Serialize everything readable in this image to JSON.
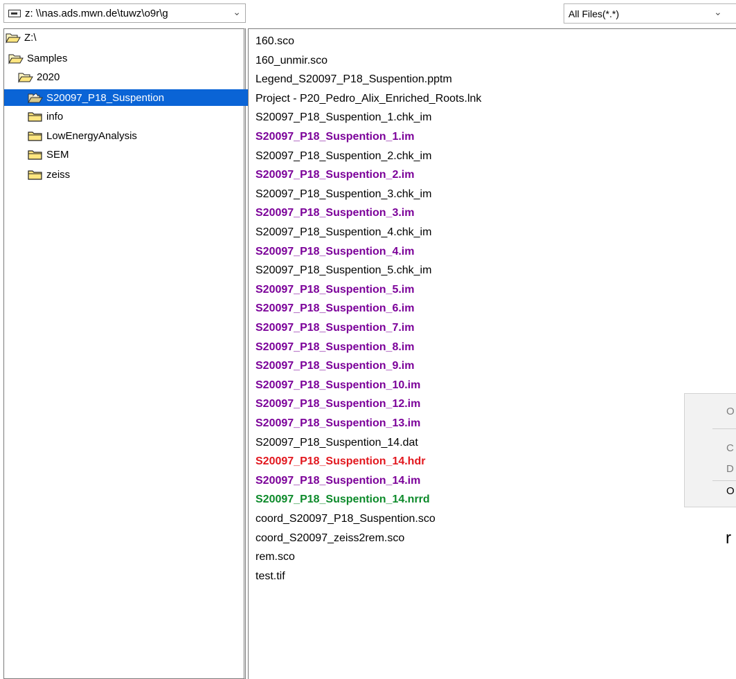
{
  "drive_combo": {
    "value": "z: \\\\nas.ads.mwn.de\\tuwz\\o9r\\g",
    "arrow": "chevron-down-icon"
  },
  "filter_combo": {
    "value": "All Files(*.*)",
    "arrow": "chevron-down-icon"
  },
  "tree": {
    "items": [
      {
        "label": "Z:\\",
        "icon": "open-folder-icon",
        "selected": false
      },
      {
        "label": "Samples",
        "icon": "open-folder-icon",
        "selected": false
      },
      {
        "label": "2020",
        "icon": "open-folder-icon",
        "selected": false
      },
      {
        "label": "S20097_P18_Suspention",
        "icon": "open-folder-icon",
        "selected": true
      },
      {
        "label": "info",
        "icon": "folder-icon",
        "selected": false
      },
      {
        "label": "LowEnergyAnalysis",
        "icon": "folder-icon",
        "selected": false
      },
      {
        "label": "SEM",
        "icon": "folder-icon",
        "selected": false
      },
      {
        "label": "zeiss",
        "icon": "folder-icon",
        "selected": false
      }
    ]
  },
  "files": [
    {
      "name": "160.sco",
      "style": "normal",
      "color": "#000000"
    },
    {
      "name": "160_unmir.sco",
      "style": "normal",
      "color": "#000000"
    },
    {
      "name": "Legend_S20097_P18_Suspention.pptm",
      "style": "normal",
      "color": "#000000"
    },
    {
      "name": "Project - P20_Pedro_Alix_Enriched_Roots.lnk",
      "style": "normal",
      "color": "#000000"
    },
    {
      "name": "S20097_P18_Suspention_1.chk_im",
      "style": "normal",
      "color": "#000000"
    },
    {
      "name": "S20097_P18_Suspention_1.im",
      "style": "bold",
      "color": "#7b0099"
    },
    {
      "name": "S20097_P18_Suspention_2.chk_im",
      "style": "normal",
      "color": "#000000"
    },
    {
      "name": "S20097_P18_Suspention_2.im",
      "style": "bold",
      "color": "#7b0099"
    },
    {
      "name": "S20097_P18_Suspention_3.chk_im",
      "style": "normal",
      "color": "#000000"
    },
    {
      "name": "S20097_P18_Suspention_3.im",
      "style": "bold",
      "color": "#7b0099"
    },
    {
      "name": "S20097_P18_Suspention_4.chk_im",
      "style": "normal",
      "color": "#000000"
    },
    {
      "name": "S20097_P18_Suspention_4.im",
      "style": "bold",
      "color": "#7b0099"
    },
    {
      "name": "S20097_P18_Suspention_5.chk_im",
      "style": "normal",
      "color": "#000000"
    },
    {
      "name": "S20097_P18_Suspention_5.im",
      "style": "bold",
      "color": "#7b0099"
    },
    {
      "name": "S20097_P18_Suspention_6.im",
      "style": "bold",
      "color": "#7b0099"
    },
    {
      "name": "S20097_P18_Suspention_7.im",
      "style": "bold",
      "color": "#7b0099"
    },
    {
      "name": "S20097_P18_Suspention_8.im",
      "style": "bold",
      "color": "#7b0099"
    },
    {
      "name": "S20097_P18_Suspention_9.im",
      "style": "bold",
      "color": "#7b0099"
    },
    {
      "name": "S20097_P18_Suspention_10.im",
      "style": "bold",
      "color": "#7b0099"
    },
    {
      "name": "S20097_P18_Suspention_12.im",
      "style": "bold",
      "color": "#7b0099"
    },
    {
      "name": "S20097_P18_Suspention_13.im",
      "style": "bold",
      "color": "#7b0099"
    },
    {
      "name": "S20097_P18_Suspention_14.dat",
      "style": "normal",
      "color": "#000000"
    },
    {
      "name": "S20097_P18_Suspention_14.hdr",
      "style": "bold",
      "color": "#e2171e"
    },
    {
      "name": "S20097_P18_Suspention_14.im",
      "style": "bold",
      "color": "#7b0099"
    },
    {
      "name": "S20097_P18_Suspention_14.nrrd",
      "style": "bold",
      "color": "#0c8a2a"
    },
    {
      "name": "coord_S20097_P18_Suspention.sco",
      "style": "normal",
      "color": "#000000"
    },
    {
      "name": "coord_S20097_zeiss2rem.sco",
      "style": "normal",
      "color": "#000000"
    },
    {
      "name": "rem.sco",
      "style": "normal",
      "color": "#000000"
    },
    {
      "name": "test.tif",
      "style": "normal",
      "color": "#000000"
    }
  ],
  "context_menu": {
    "items": [
      "O",
      "C",
      "D",
      "O"
    ]
  },
  "edge_text": "r"
}
